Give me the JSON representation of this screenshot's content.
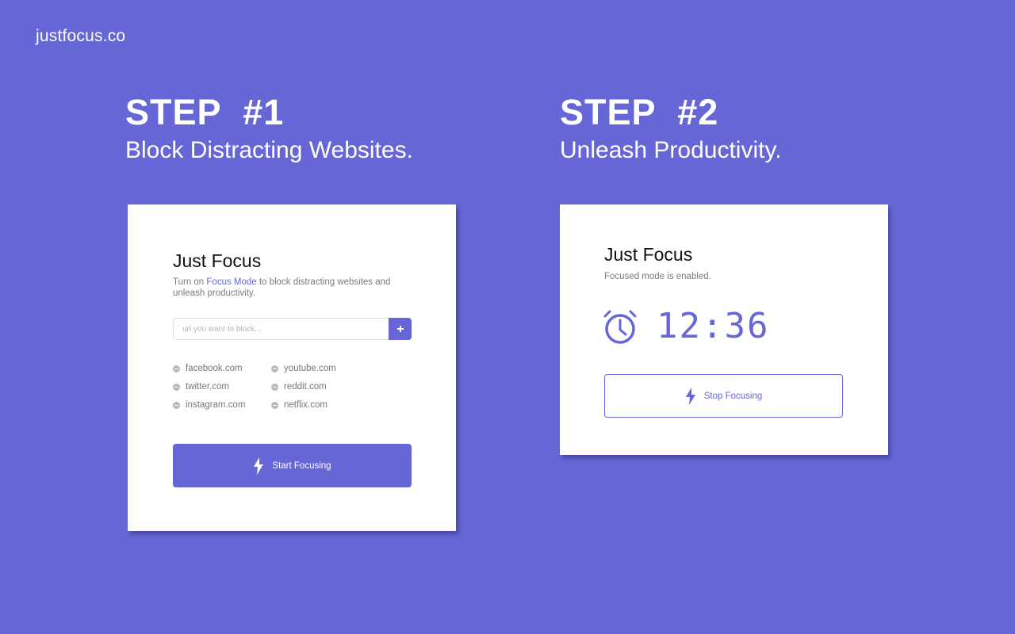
{
  "brand": "justfocus.co",
  "colors": {
    "background": "#6766d6",
    "accent": "#6766d6",
    "card": "#ffffff"
  },
  "steps": [
    {
      "title": "STEP #1",
      "subtitle": "Block Distracting Websites.",
      "card": {
        "title": "Just Focus",
        "description_before": "Turn on ",
        "description_highlight": "Focus Mode",
        "description_after": " to block distracting websites and unleash productivity.",
        "url_input": {
          "placeholder": "url you want to block...",
          "value": ""
        },
        "add_button_icon": "plus-icon",
        "blocked_sites": [
          "facebook.com",
          "youtube.com",
          "twitter.com",
          "reddit.com",
          "instagram.com",
          "netflix.com"
        ],
        "start_button": {
          "label": "Start Focusing",
          "icon": "lightning-icon"
        }
      }
    },
    {
      "title": "STEP #2",
      "subtitle": "Unleash Productivity.",
      "card": {
        "title": "Just Focus",
        "status": "Focused mode is enabled.",
        "timer_icon": "alarm-clock-icon",
        "timer": "12:36",
        "stop_button": {
          "label": "Stop Focusing",
          "icon": "lightning-icon"
        }
      }
    }
  ]
}
